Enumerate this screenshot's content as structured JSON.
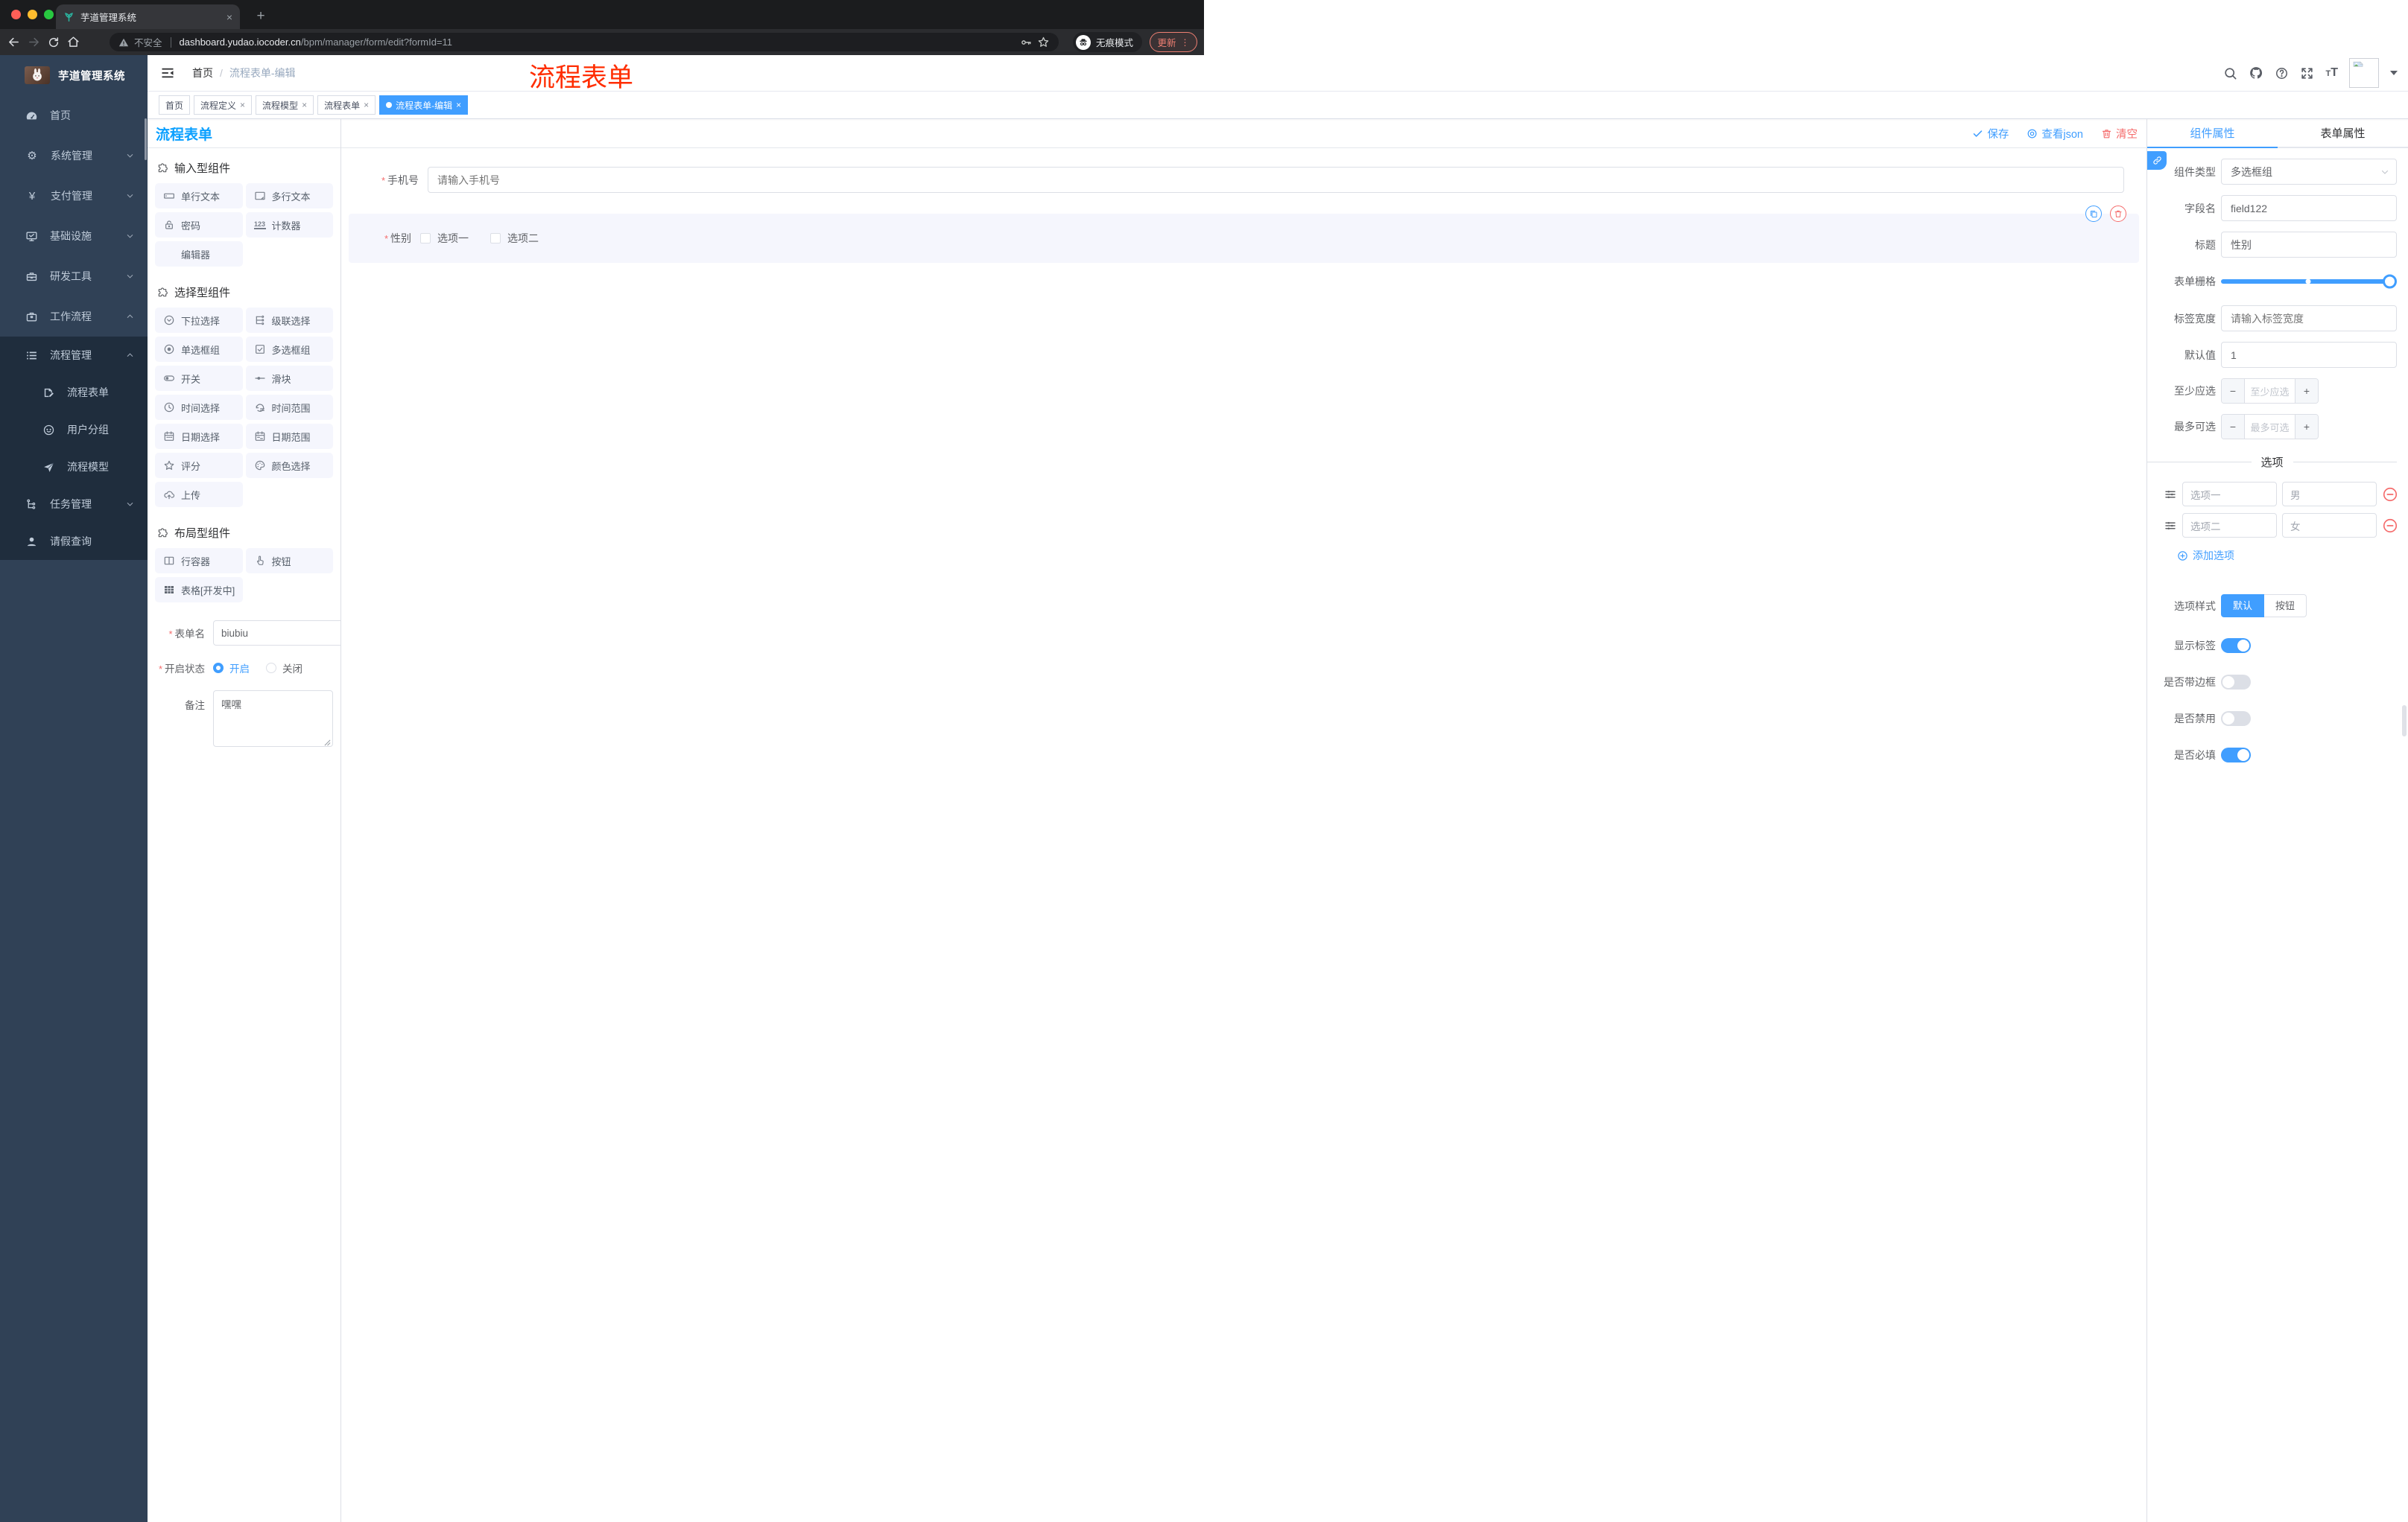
{
  "symbols": {
    "close": "×",
    "plus": "+",
    "minus": "−",
    "caret_plus": "+",
    "slash": "/",
    "asterisk": "*",
    "vdots": "⋮",
    "gear": "⚙",
    "yen": "¥"
  },
  "browser": {
    "tab_title": "芋道管理系统",
    "security": "不安全",
    "url_domain": "dashboard.yudao.iocoder.cn",
    "url_path": "/bpm/manager/form/edit?formId=11",
    "incognito": "无痕模式",
    "update": "更新"
  },
  "sidebar": {
    "title": "芋道管理系统",
    "items": [
      "首页",
      "系统管理",
      "支付管理",
      "基础设施",
      "研发工具",
      "工作流程",
      "流程管理",
      "流程表单",
      "用户分组",
      "流程模型",
      "任务管理",
      "请假查询"
    ]
  },
  "header": {
    "breadcrumb_home": "首页",
    "breadcrumb_current": "流程表单-编辑",
    "annotation": "流程表单",
    "font_small": "T",
    "font_big": "T"
  },
  "tags": [
    "首页",
    "流程定义",
    "流程模型",
    "流程表单",
    "流程表单-编辑"
  ],
  "palette": {
    "title": "流程表单",
    "sections": [
      {
        "title": "输入型组件",
        "items": [
          "单行文本",
          "多行文本",
          "密码",
          "计数器",
          "编辑器"
        ]
      },
      {
        "title": "选择型组件",
        "items": [
          "下拉选择",
          "级联选择",
          "单选框组",
          "多选框组",
          "开关",
          "滑块",
          "时间选择",
          "时间范围",
          "日期选择",
          "日期范围",
          "评分",
          "颜色选择",
          "上传"
        ]
      },
      {
        "title": "布局型组件",
        "items": [
          "行容器",
          "按钮",
          "表格[开发中]"
        ]
      }
    ],
    "form": {
      "name_label": "表单名",
      "name_value": "biubiu",
      "status_label": "开启状态",
      "on": "开启",
      "off": "关闭",
      "remark_label": "备注",
      "remark_value": "嘿嘿"
    }
  },
  "canvas": {
    "save": "保存",
    "view_json": "查看json",
    "clear": "清空",
    "phone_label": "手机号",
    "phone_placeholder": "请输入手机号",
    "gender_label": "性别",
    "opt1": "选项一",
    "opt2": "选项二"
  },
  "panel": {
    "tab_component": "组件属性",
    "tab_form": "表单属性",
    "type_label": "组件类型",
    "type_value": "多选框组",
    "field_label": "字段名",
    "field_value": "field122",
    "title_label": "标题",
    "title_value": "性别",
    "grid_label": "表单栅格",
    "width_label": "标签宽度",
    "width_placeholder": "请输入标签宽度",
    "default_label": "默认值",
    "default_value": "1",
    "min_label": "至少应选",
    "min_placeholder": "至少应选",
    "max_label": "最多可选",
    "max_placeholder": "最多可选",
    "options_title": "选项",
    "options": [
      {
        "label": "选项一",
        "value": "男"
      },
      {
        "label": "选项二",
        "value": "女"
      }
    ],
    "add_option": "添加选项",
    "style_label": "选项样式",
    "style_default": "默认",
    "style_button": "按钮",
    "toggles": [
      {
        "label": "显示标签"
      },
      {
        "label": "是否带边框"
      },
      {
        "label": "是否禁用"
      },
      {
        "label": "是否必填"
      }
    ]
  }
}
